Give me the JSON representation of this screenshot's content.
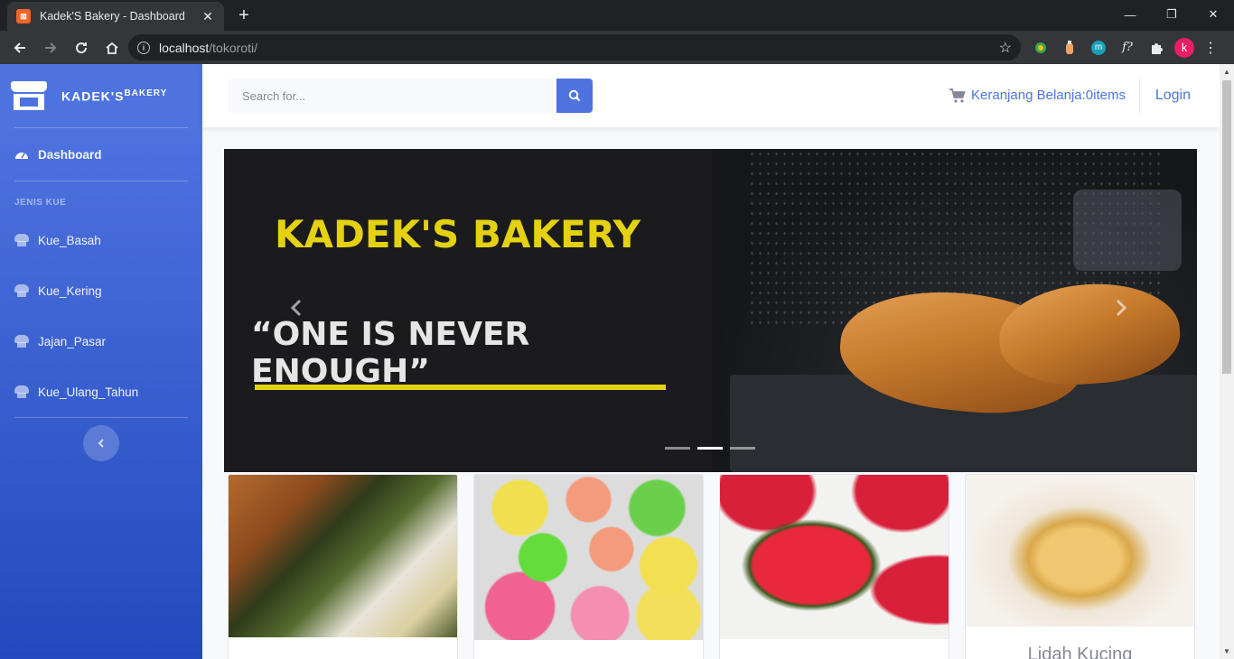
{
  "browser": {
    "tab_title": "Kadek'S Bakery - Dashboard",
    "tab_favicon": "xampp",
    "url_host": "localhost",
    "url_path": "/tokoroti/",
    "avatar_letter": "k",
    "ext_m_letter": "m",
    "ext_f_label": "f?"
  },
  "sidebar": {
    "brand_main": "KADEK'S",
    "brand_sup": "BAKERY",
    "dashboard_label": "Dashboard",
    "section_heading": "JENIS KUE",
    "items": [
      {
        "label": "Kue_Basah"
      },
      {
        "label": "Kue_Kering"
      },
      {
        "label": "Jajan_Pasar"
      },
      {
        "label": "Kue_Ulang_Tahun"
      }
    ]
  },
  "topbar": {
    "search_placeholder": "Search for...",
    "cart_label": "Keranjang Belanja:0items",
    "login_label": "Login"
  },
  "carousel": {
    "title": "KADEK'S BAKERY",
    "quote": "“ONE IS NEVER ENOUGH”",
    "active_index": 1,
    "slide_count": 3
  },
  "products": [
    {
      "name": "",
      "image": "kue-basah-pisang"
    },
    {
      "name": "",
      "image": "kue-mangkok-warna"
    },
    {
      "name": "",
      "image": "kue-ku-merah"
    },
    {
      "name": "Lidah Kucing",
      "image": "kue-lidah-kucing"
    }
  ],
  "colors": {
    "primary": "#4e73df",
    "sidebar_dark": "#224abe",
    "accent_yellow": "#e3d112"
  }
}
